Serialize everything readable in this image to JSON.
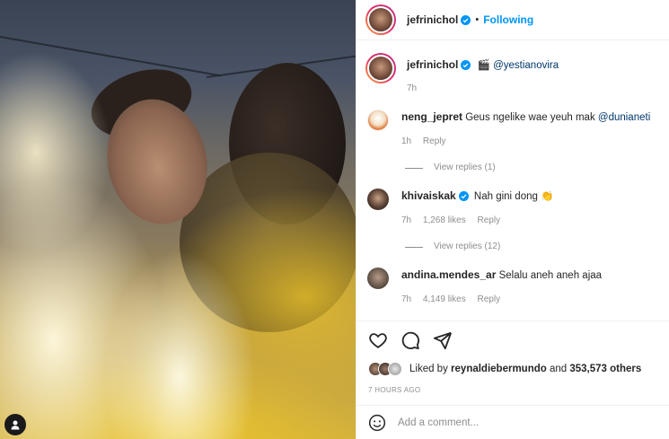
{
  "post": {
    "author": "jefrinichol",
    "follow_label": "Following",
    "caption_author": "jefrinichol",
    "caption_emoji": "🎬",
    "caption_mention": "@yestianovira",
    "caption_time": "7h",
    "verified_color": "#0095f6"
  },
  "comments": [
    {
      "user": "neng_jepret",
      "text": "Geus ngelike wae yeuh mak ",
      "mention": "@dunianeti",
      "time": "1h",
      "likes": "",
      "reply": "Reply",
      "view_replies": "View replies (1)"
    },
    {
      "user": "khivaiskak",
      "text": "Nah gini dong 👏",
      "mention": "",
      "time": "7h",
      "likes": "1,268 likes",
      "reply": "Reply",
      "view_replies": "View replies (12)"
    },
    {
      "user": "andina.mendes_ar",
      "text": "Selalu aneh aneh ajaa",
      "mention": "",
      "time": "7h",
      "likes": "4,149 likes",
      "reply": "Reply",
      "view_replies": ""
    }
  ],
  "liked_by": {
    "prefix": "Liked by ",
    "user": "reynaldiebermundo",
    "middle": " and ",
    "count": "353,573 others"
  },
  "timestamp": "7 HOURS AGO",
  "add_comment_placeholder": "Add a comment...",
  "icons": [
    "heart-icon",
    "comment-icon",
    "share-icon",
    "emoji-icon",
    "account-icon",
    "verified-icon"
  ]
}
